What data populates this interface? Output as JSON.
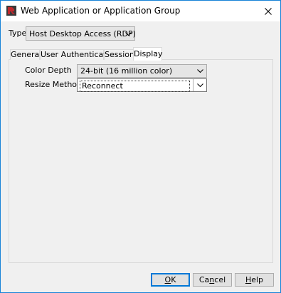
{
  "window": {
    "title": "Web Application or Application Group"
  },
  "type_field": {
    "label": "Type",
    "value": "Host Desktop Access (RDP)"
  },
  "tabs": [
    {
      "label": "General",
      "active": false
    },
    {
      "label": "User Authentication",
      "active": false
    },
    {
      "label": "Session",
      "active": false
    },
    {
      "label": "Display",
      "active": true
    }
  ],
  "display": {
    "color_depth_label": "Color Depth",
    "color_depth_value": "24-bit (16 million color)",
    "resize_method_label": "Resize Method",
    "resize_method_value": "Reconnect"
  },
  "buttons": {
    "ok_mnemonic": "O",
    "ok_rest": "K",
    "cancel_first": "Ca",
    "cancel_mnemonic": "n",
    "cancel_rest": "cel",
    "help_mnemonic": "H",
    "help_rest": "elp"
  },
  "colors": {
    "window_border": "#1883d7",
    "default_button_border": "#0078d7",
    "app_icon_red": "#c0282d"
  },
  "icons": {
    "app": "app-icon",
    "close": "close-icon",
    "dropdown": "chevron-down-icon"
  }
}
